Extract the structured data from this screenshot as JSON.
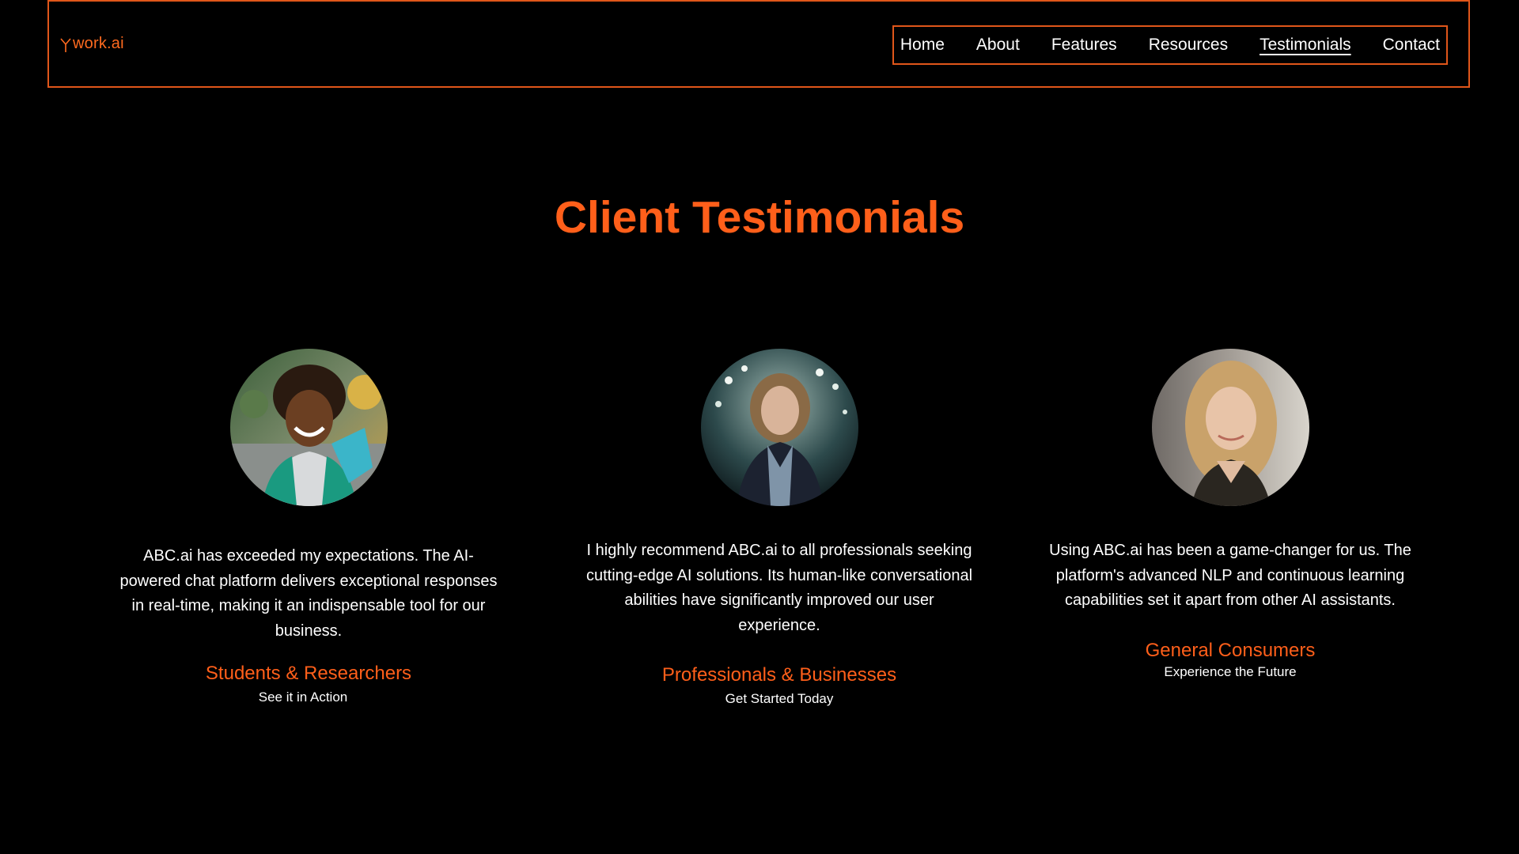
{
  "header": {
    "logo_text": "work.ai",
    "nav": [
      {
        "label": "Home",
        "active": false
      },
      {
        "label": "About",
        "active": false
      },
      {
        "label": "Features",
        "active": false
      },
      {
        "label": "Resources",
        "active": false
      },
      {
        "label": "Testimonials",
        "active": true
      },
      {
        "label": "Contact",
        "active": false
      }
    ]
  },
  "main": {
    "title": "Client Testimonials",
    "testimonials": [
      {
        "avatar_icon": "student-portrait-photo",
        "quote": "ABC.ai has exceeded my expectations. The AI-powered chat platform delivers exceptional responses in real-time, making it an indispensable tool for our business.",
        "category": "Students & Researchers",
        "cta": "See it in Action"
      },
      {
        "avatar_icon": "professional-portrait-photo",
        "quote": "I highly recommend ABC.ai to all professionals seeking cutting-edge AI solutions. Its human-like conversational abilities have significantly improved our user experience.",
        "category": "Professionals & Businesses",
        "cta": "Get Started Today"
      },
      {
        "avatar_icon": "consumer-portrait-photo",
        "quote": "Using ABC.ai has been a game-changer for us. The platform's advanced NLP and continuous learning capabilities set it apart from other AI assistants.",
        "category": "General Consumers",
        "cta": "Experience the Future"
      }
    ]
  },
  "colors": {
    "accent": "#ff5f1a",
    "border": "#e0561a",
    "background": "#000000",
    "text": "#ffffff"
  }
}
